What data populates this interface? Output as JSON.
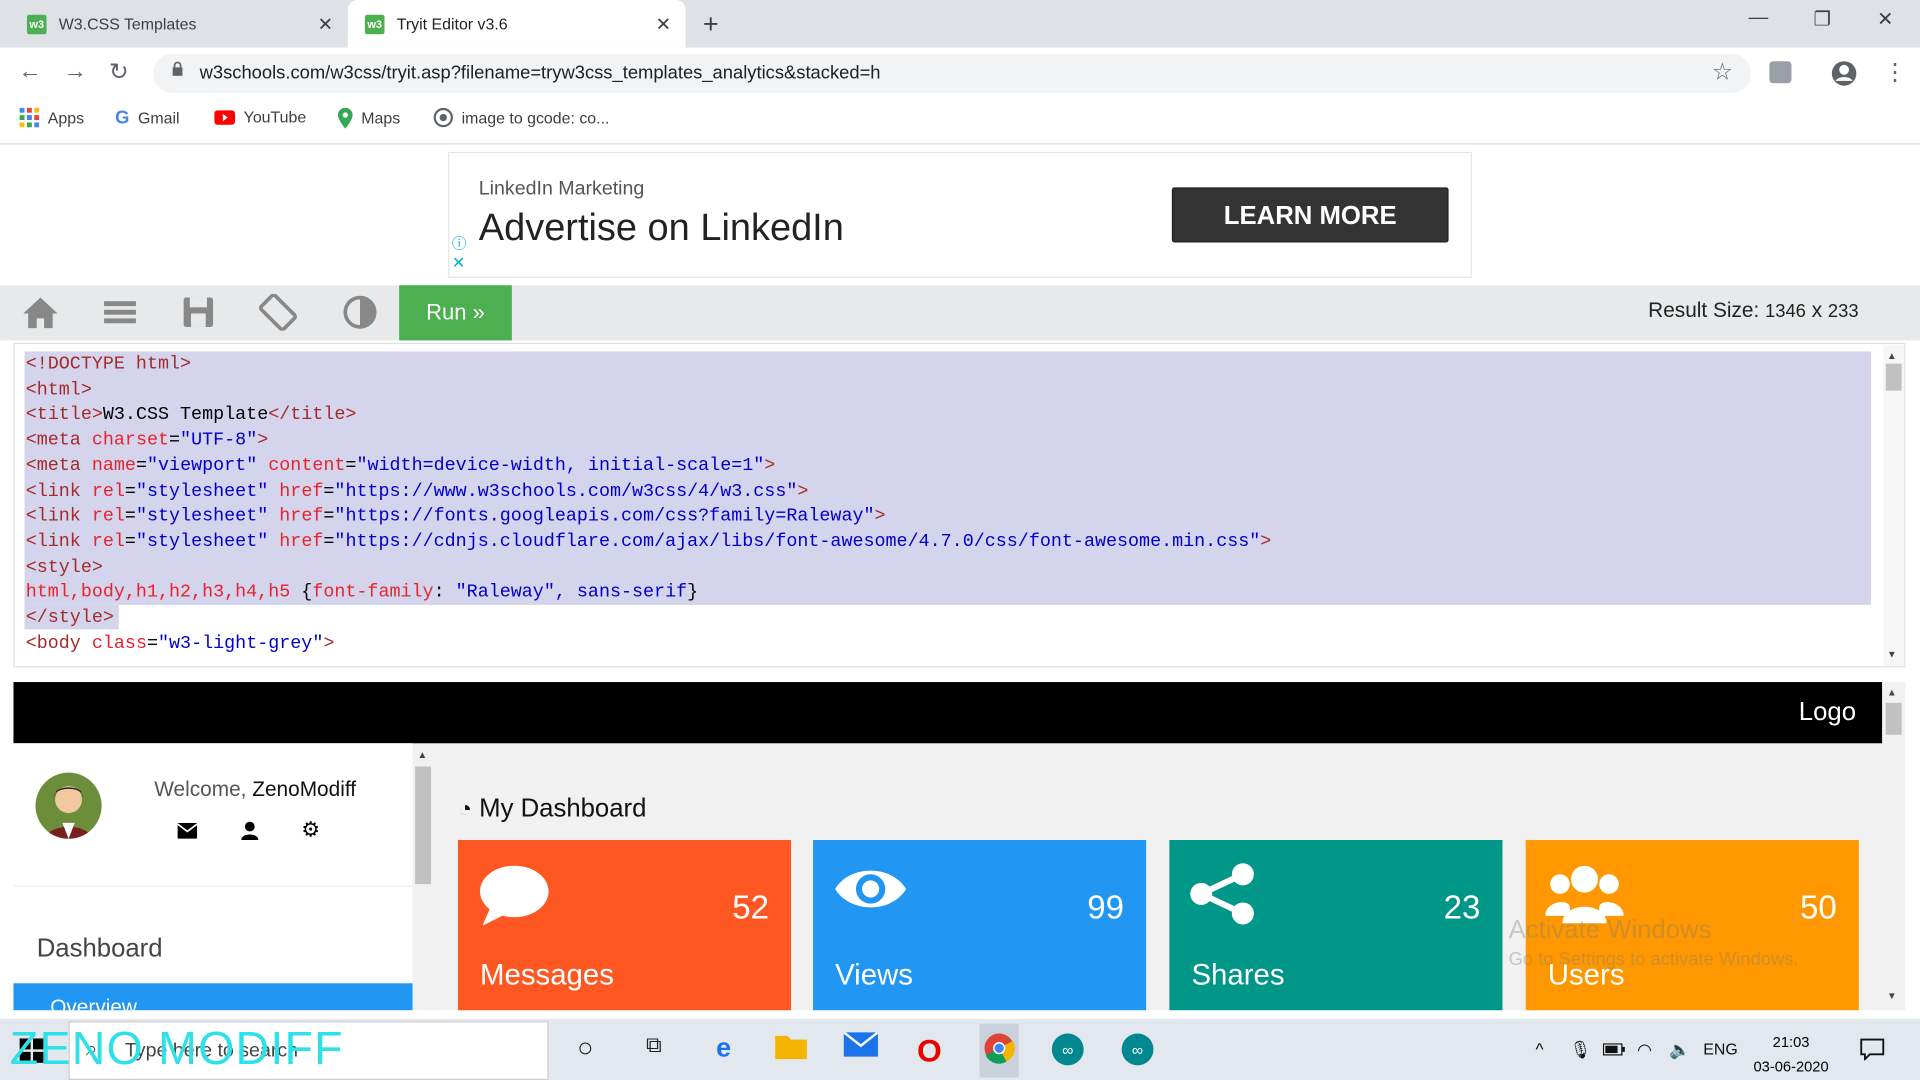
{
  "browser": {
    "tabs": [
      {
        "label": "W3.CSS Templates"
      },
      {
        "label": "Tryit Editor v3.6"
      }
    ],
    "new_tab": "+",
    "url": "w3schools.com/w3css/tryit.asp?filename=tryw3css_templates_analytics&stacked=h",
    "bookmarks": [
      "Apps",
      "Gmail",
      "YouTube",
      "Maps",
      "image to gcode: co..."
    ]
  },
  "ad": {
    "small": "LinkedIn Marketing",
    "big": "Advertise on LinkedIn",
    "button": "LEARN MORE"
  },
  "editor": {
    "run_label": "Run »",
    "result_label": "Result Size:",
    "result_w": "1346",
    "result_x": "x",
    "result_h": "233",
    "code": [
      [
        [
          "tg",
          "<!DOCTYPE html>"
        ]
      ],
      [
        [
          "tg",
          "<html>"
        ]
      ],
      [
        [
          "tg",
          "<title>"
        ],
        [
          "tx",
          "W3.CSS Template"
        ],
        [
          "tg",
          "</title>"
        ]
      ],
      [
        [
          "tg",
          "<meta "
        ],
        [
          "at",
          "charset"
        ],
        [
          "tx",
          "="
        ],
        [
          "vl",
          "\"UTF-8\""
        ],
        [
          "tg",
          ">"
        ]
      ],
      [
        [
          "tg",
          "<meta "
        ],
        [
          "at",
          "name"
        ],
        [
          "tx",
          "="
        ],
        [
          "vl",
          "\"viewport\" "
        ],
        [
          "at",
          "content"
        ],
        [
          "tx",
          "="
        ],
        [
          "vl",
          "\"width=device-width, initial-scale=1\""
        ],
        [
          "tg",
          ">"
        ]
      ],
      [
        [
          "tg",
          "<link "
        ],
        [
          "at",
          "rel"
        ],
        [
          "tx",
          "="
        ],
        [
          "vl",
          "\"stylesheet\" "
        ],
        [
          "at",
          "href"
        ],
        [
          "tx",
          "="
        ],
        [
          "vl",
          "\"https://www.w3schools.com/w3css/4/w3.css\""
        ],
        [
          "tg",
          ">"
        ]
      ],
      [
        [
          "tg",
          "<link "
        ],
        [
          "at",
          "rel"
        ],
        [
          "tx",
          "="
        ],
        [
          "vl",
          "\"stylesheet\" "
        ],
        [
          "at",
          "href"
        ],
        [
          "tx",
          "="
        ],
        [
          "vl",
          "\"https://fonts.googleapis.com/css?family=Raleway\""
        ],
        [
          "tg",
          ">"
        ]
      ],
      [
        [
          "tg",
          "<link "
        ],
        [
          "at",
          "rel"
        ],
        [
          "tx",
          "="
        ],
        [
          "vl",
          "\"stylesheet\" "
        ],
        [
          "at",
          "href"
        ],
        [
          "tx",
          "="
        ],
        [
          "vl",
          "\"https://cdnjs.cloudflare.com/ajax/libs/font-awesome/4.7.0/css/font-awesome.min.css\""
        ],
        [
          "tg",
          ">"
        ]
      ],
      [
        [
          "tg",
          "<style>"
        ]
      ],
      [
        [
          "at",
          "html,body,h1,h2,h3,h4,h5 "
        ],
        [
          "tx",
          "{"
        ],
        [
          "at",
          "font-family"
        ],
        [
          "tx",
          ": "
        ],
        [
          "vl",
          "\"Raleway\", sans-serif"
        ],
        [
          "tx",
          "}"
        ]
      ],
      [
        [
          "tg",
          "</style>"
        ]
      ],
      [
        [
          "tg",
          "<body "
        ],
        [
          "at",
          "class"
        ],
        [
          "tx",
          "="
        ],
        [
          "vl",
          "\"w3-light-grey\""
        ],
        [
          "tg",
          ">"
        ]
      ]
    ]
  },
  "result": {
    "logo": "Logo",
    "welcome_prefix": "Welcome, ",
    "user": "ZenoModiff",
    "dashboard": "Dashboard",
    "overview": "Overview",
    "my_dashboard": "My Dashboard",
    "cards": [
      {
        "label": "Messages",
        "value": "52",
        "color": "#ff5722",
        "icon": "comment-icon"
      },
      {
        "label": "Views",
        "value": "99",
        "color": "#2196f3",
        "icon": "eye-icon"
      },
      {
        "label": "Shares",
        "value": "23",
        "color": "#009688",
        "icon": "share-icon"
      },
      {
        "label": "Users",
        "value": "50",
        "color": "#ff9800",
        "icon": "users-icon"
      }
    ],
    "watermark_1": "Activate Windows",
    "watermark_2": "Go to Settings to activate Windows."
  },
  "taskbar": {
    "search_placeholder": "Type here to search",
    "overlay_text": "ZENO MODIFF",
    "lang": "ENG",
    "time": "21:03",
    "date": "03-06-2020"
  }
}
